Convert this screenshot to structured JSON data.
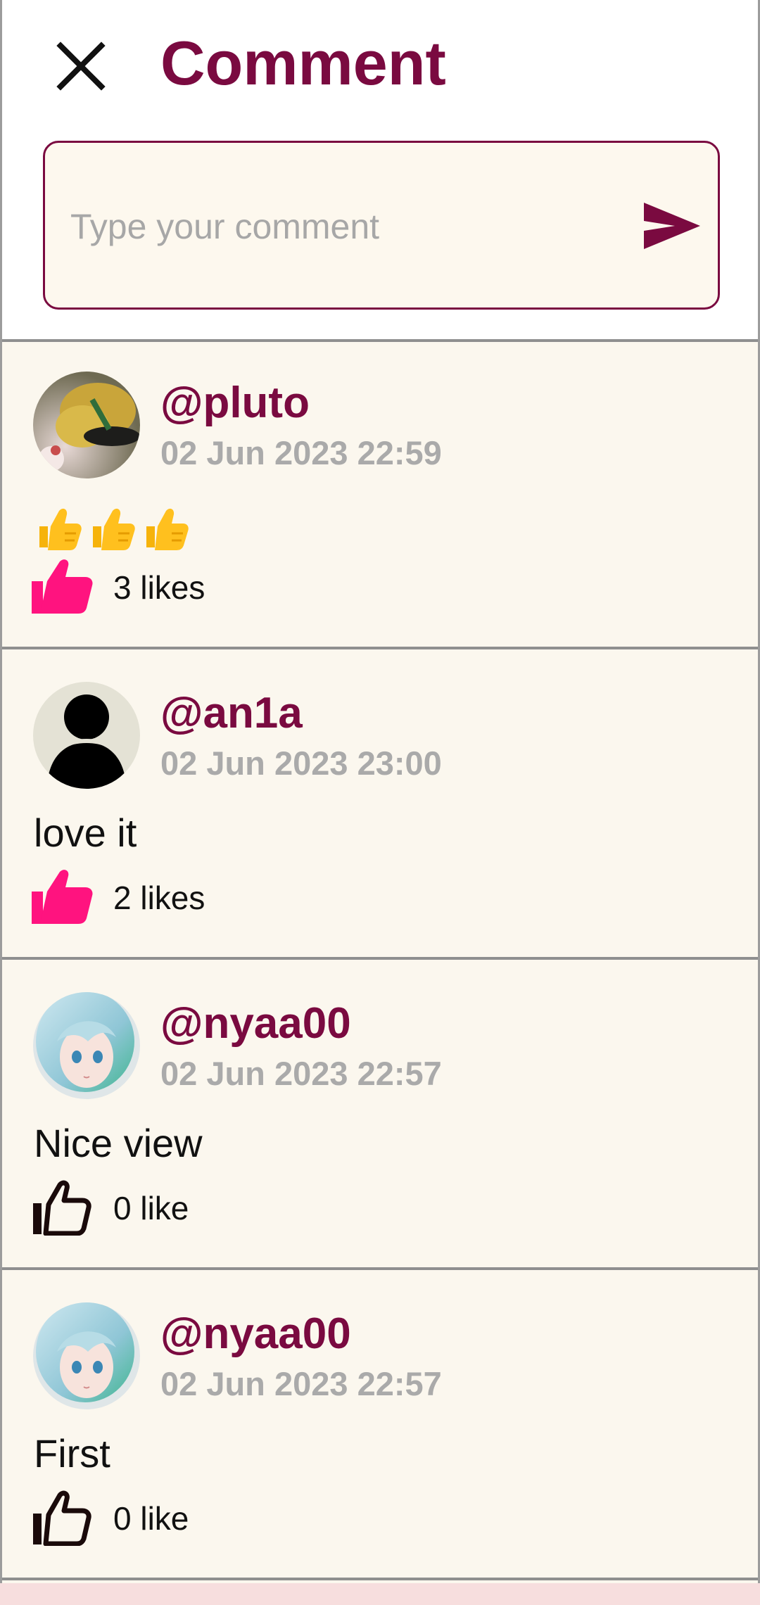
{
  "header": {
    "title": "Comment",
    "close_icon": "close-icon",
    "input_placeholder": "Type your comment",
    "send_icon": "send-icon"
  },
  "colors": {
    "brand": "#7a0a40",
    "liked": "#ff137f",
    "card_bg": "#fbf7ee",
    "muted": "#aaaaaa"
  },
  "comments": [
    {
      "username": "@pluto",
      "timestamp": "02 Jun 2023 22:59",
      "text": "👍👍👍",
      "likes": "3 likes",
      "liked": true,
      "avatar": "photo-avatar"
    },
    {
      "username": "@an1a",
      "timestamp": "02 Jun 2023 23:00",
      "text": "love it",
      "likes": "2 likes",
      "liked": true,
      "avatar": "default-person-avatar"
    },
    {
      "username": "@nyaa00",
      "timestamp": "02 Jun 2023 22:57",
      "text": "Nice view",
      "likes": "0 like",
      "liked": false,
      "avatar": "anime-avatar"
    },
    {
      "username": "@nyaa00",
      "timestamp": "02 Jun 2023 22:57",
      "text": "First",
      "likes": "0 like",
      "liked": false,
      "avatar": "anime-avatar"
    }
  ]
}
